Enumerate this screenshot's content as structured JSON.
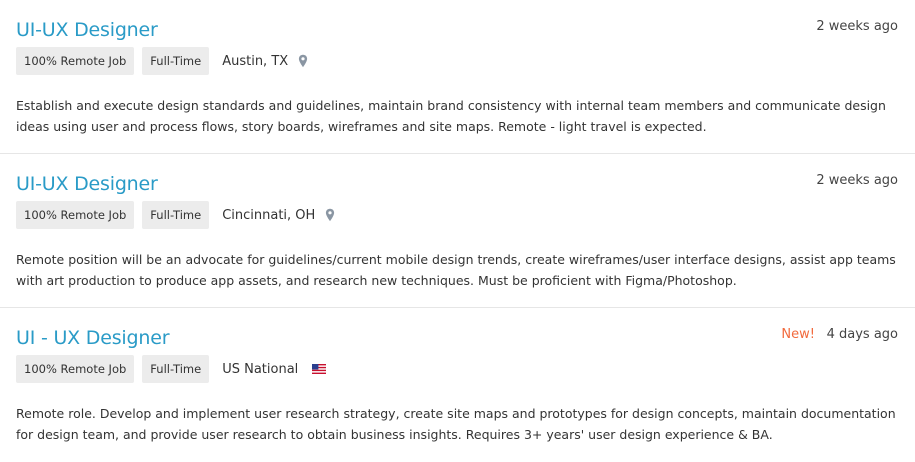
{
  "jobs": [
    {
      "title": "UI-UX Designer",
      "age": "2 weeks ago",
      "badge": "",
      "tags": [
        "100% Remote Job",
        "Full-Time"
      ],
      "location": "Austin, TX",
      "location_icon": "map-pin-icon",
      "description": "Establish and execute design standards and guidelines, maintain brand consistency with internal team members and communicate design ideas using user and process flows, story boards, wireframes and site maps. Remote - light travel is expected."
    },
    {
      "title": "UI-UX Designer",
      "age": "2 weeks ago",
      "badge": "",
      "tags": [
        "100% Remote Job",
        "Full-Time"
      ],
      "location": "Cincinnati, OH",
      "location_icon": "map-pin-icon",
      "description": "Remote position will be an advocate for guidelines/current mobile design trends, create wireframes/user interface designs, assist app teams with art production to produce app assets, and research new techniques. Must be proficient with Figma/Photoshop."
    },
    {
      "title": "UI - UX Designer",
      "age": "4 days ago",
      "badge": "New!",
      "tags": [
        "100% Remote Job",
        "Full-Time"
      ],
      "location": "US National",
      "location_icon": "us-flag-icon",
      "description": "Remote role. Develop and implement user research strategy, create site maps and prototypes for design concepts, maintain documentation for design team, and provide user research to obtain business insights. Requires 3+ years' user design experience & BA."
    }
  ],
  "colors": {
    "title": "#2a9bc7",
    "new_badge": "#f26a3d",
    "tag_bg": "#ececec",
    "divider": "#e6e6e6"
  }
}
